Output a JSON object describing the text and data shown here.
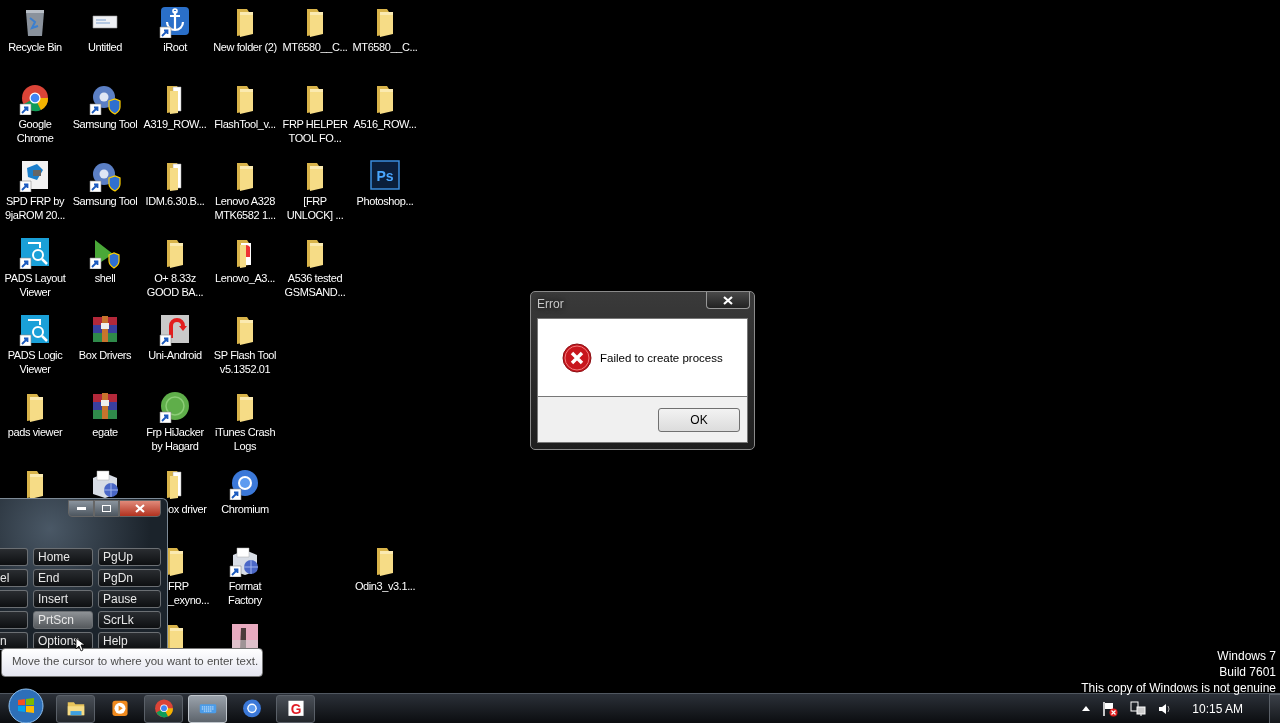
{
  "desktop": {
    "columns": [
      {
        "icons": [
          {
            "kind": "recycle-bin",
            "label": "Recycle Bin",
            "shortcut": false
          },
          {
            "kind": "round-browser",
            "label": "Google Chrome",
            "shortcut": true
          },
          {
            "kind": "spd",
            "label": "SPD FRP by 9jaROM 20...",
            "shortcut": true
          },
          {
            "kind": "pads",
            "label": "PADS Layout Viewer",
            "shortcut": true
          },
          {
            "kind": "pads",
            "label": "PADS Logic Viewer",
            "shortcut": true
          },
          {
            "kind": "folder",
            "label": "pads viewer",
            "shortcut": false
          },
          {
            "kind": "folder",
            "shortcut": false
          }
        ]
      },
      {
        "icons": [
          {
            "kind": "document",
            "label": "Untitled",
            "shortcut": false
          },
          {
            "kind": "gear-shield",
            "label": "Samsung Tool",
            "shortcut": true
          },
          {
            "kind": "gear-shield",
            "label": "Samsung Tool",
            "shortcut": true
          },
          {
            "kind": "shell",
            "label": "shell",
            "shortcut": true
          },
          {
            "kind": "archive",
            "label": "Box Drivers",
            "shortcut": false
          },
          {
            "kind": "archive",
            "label": "egate",
            "shortcut": false
          },
          {
            "kind": "installer",
            "shortcut": false
          }
        ]
      },
      {
        "icons": [
          {
            "kind": "anchor",
            "label": "iRoot",
            "shortcut": true
          },
          {
            "kind": "folder-files",
            "label": "A319_ROW...",
            "shortcut": false
          },
          {
            "kind": "folder-files",
            "label": "IDM.6.30.B...",
            "shortcut": false
          },
          {
            "kind": "folder",
            "label": "O+ 8.33z GOOD BA...",
            "shortcut": false
          },
          {
            "kind": "uni-android",
            "label": "Uni-Android",
            "shortcut": true
          },
          {
            "kind": "green-circle",
            "label": "Frp HiJacker by Hagard",
            "shortcut": true
          },
          {
            "kind": "folder-files",
            "label": "ox driver",
            "shortcut": false,
            "clipped": true
          },
          {
            "kind": "folder",
            "label": "FRP _exyno...",
            "shortcut": false,
            "clipped": true
          },
          {
            "kind": "folder",
            "shortcut": false
          }
        ]
      },
      {
        "icons": [
          {
            "kind": "folder",
            "label": "New folder (2)",
            "shortcut": false
          },
          {
            "kind": "folder",
            "label": "FlashTool_v...",
            "shortcut": false
          },
          {
            "kind": "folder",
            "label": "Lenovo A328 MTK6582 1...",
            "shortcut": false
          },
          {
            "kind": "folder-colored",
            "label": "Lenovo_A3...",
            "shortcut": false
          },
          {
            "kind": "folder",
            "label": "SP Flash Tool v5.1352.01",
            "shortcut": false
          },
          {
            "kind": "folder",
            "label": "iTunes Crash Logs",
            "shortcut": false
          },
          {
            "kind": "blue-circle",
            "label": "Chromium",
            "shortcut": true
          },
          {
            "kind": "installer",
            "label": "Format Factory",
            "shortcut": true
          },
          {
            "kind": "image",
            "shortcut": false
          }
        ]
      },
      {
        "icons": [
          {
            "kind": "folder",
            "label": "MT6580__C...",
            "shortcut": false
          },
          {
            "kind": "folder",
            "label": "FRP HELPER TOOL FO...",
            "shortcut": false
          },
          {
            "kind": "folder",
            "label": "[FRP UNLOCK] ...",
            "shortcut": false
          },
          {
            "kind": "folder",
            "label": "A536 tested GSMSAND...",
            "shortcut": false
          }
        ]
      },
      {
        "icons": [
          {
            "kind": "folder",
            "label": "MT6580__C...",
            "shortcut": false
          },
          {
            "kind": "folder",
            "label": "A516_ROW...",
            "shortcut": false
          },
          {
            "kind": "photo-editor",
            "label": "Photoshop...",
            "glyph": "Ps",
            "shortcut": false
          },
          {
            "kind": "blank"
          },
          {
            "kind": "blank"
          },
          {
            "kind": "blank"
          },
          {
            "kind": "blank"
          },
          {
            "kind": "folder",
            "label": "Odin3_v3.1...",
            "shortcut": false
          }
        ]
      }
    ]
  },
  "dialog": {
    "title": "Error",
    "message": "Failed to create process",
    "button": "OK"
  },
  "osk": {
    "rows": [
      {
        "keys": [
          {
            "kind": "partial"
          },
          {
            "kind": "key",
            "label": "Home",
            "highlighted": false
          },
          {
            "kind": "key",
            "label": "PgUp",
            "highlighted": false
          }
        ]
      },
      {
        "keys": [
          {
            "kind": "partial",
            "label": "el"
          },
          {
            "kind": "key",
            "label": "End",
            "highlighted": false
          },
          {
            "kind": "key",
            "label": "PgDn",
            "highlighted": false
          }
        ]
      },
      {
        "keys": [
          {
            "kind": "partial"
          },
          {
            "kind": "key",
            "label": "Insert",
            "highlighted": false
          },
          {
            "kind": "key",
            "label": "Pause",
            "highlighted": false
          }
        ]
      },
      {
        "keys": [
          {
            "kind": "partial"
          },
          {
            "kind": "key",
            "label": "PrtScn",
            "highlighted": true
          },
          {
            "kind": "key",
            "label": "ScrLk",
            "highlighted": false
          }
        ]
      },
      {
        "keys": [
          {
            "kind": "partial",
            "label": "n"
          },
          {
            "kind": "key",
            "label": "Options",
            "highlighted": false
          },
          {
            "kind": "key",
            "label": "Help",
            "highlighted": false
          }
        ]
      }
    ]
  },
  "tooltip": "Move the cursor to where you want to enter text.",
  "genuine_notice": [
    "Windows 7",
    "Build 7601",
    "This copy of Windows is not genuine"
  ],
  "taskbar": {
    "apps": [
      {
        "kind": "explorer",
        "running": true,
        "selected": false
      },
      {
        "kind": "media",
        "running": false,
        "selected": false
      },
      {
        "kind": "round-browser",
        "running": true,
        "selected": false
      },
      {
        "kind": "keyboard",
        "running": true,
        "selected": true
      },
      {
        "kind": "blue-circle",
        "running": false,
        "selected": false
      },
      {
        "kind": "glyph-app",
        "glyph": "G",
        "running": true,
        "selected": false
      }
    ],
    "clock": "10:15 AM"
  }
}
